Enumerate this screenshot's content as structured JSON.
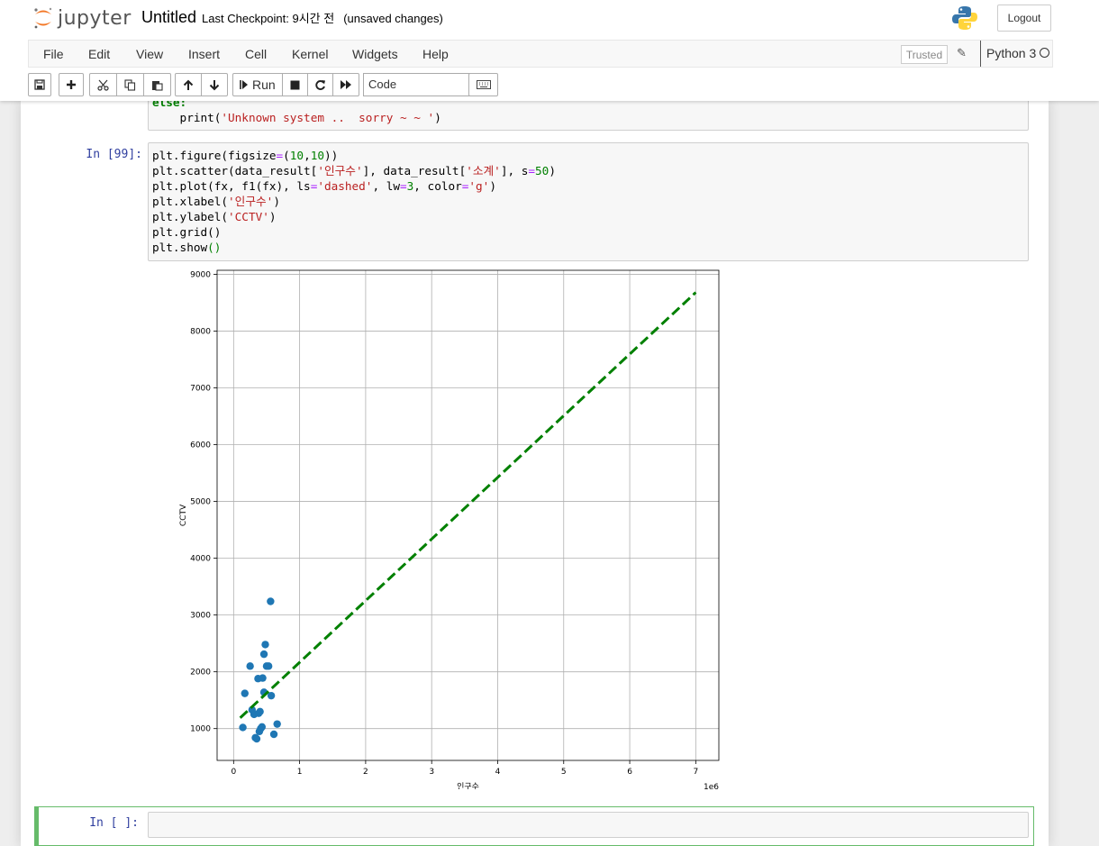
{
  "header": {
    "brand": "jupyter",
    "notebook_name": "Untitled",
    "checkpoint": "Last Checkpoint: 9시간 전",
    "autosave_status": "(unsaved changes)",
    "logout_label": "Logout"
  },
  "menu": {
    "items": [
      "File",
      "Edit",
      "View",
      "Insert",
      "Cell",
      "Kernel",
      "Widgets",
      "Help"
    ],
    "trusted_label": "Trusted",
    "kernel_name": "Python 3"
  },
  "toolbar": {
    "run_label": "Run",
    "cell_type": "Code"
  },
  "cells": {
    "prev_cell_lines": [
      "else:",
      "    print('Unknown system ..  sorry ~ ~ ')"
    ],
    "code_cell_prompt": "In [99]:",
    "code_lines": [
      "plt.figure(figsize=(10,10))",
      "plt.scatter(data_result['인구수'], data_result['소계'], s=50)",
      "plt.plot(fx, f1(fx), ls='dashed', lw=3, color='g')",
      "plt.xlabel('인구수')",
      "plt.ylabel('CCTV')",
      "plt.grid()",
      "plt.show()"
    ],
    "empty_cell_prompt": "In [ ]:"
  },
  "chart_data": {
    "type": "scatter",
    "xlabel": "인구수",
    "ylabel": "CCTV",
    "x_offset_label": "1e6",
    "xlim": [
      -0.25,
      7.35
    ],
    "ylim": [
      440,
      9070
    ],
    "xticks": [
      0,
      1,
      2,
      3,
      4,
      5,
      6,
      7
    ],
    "yticks": [
      1000,
      2000,
      3000,
      4000,
      5000,
      6000,
      7000,
      8000,
      9000
    ],
    "grid": true,
    "series": [
      {
        "kind": "scatter",
        "color": "#1f77b4",
        "points": [
          [
            0.14,
            1020
          ],
          [
            0.17,
            1620
          ],
          [
            0.25,
            2100
          ],
          [
            0.28,
            1330
          ],
          [
            0.31,
            1250
          ],
          [
            0.33,
            840
          ],
          [
            0.35,
            820
          ],
          [
            0.37,
            1880
          ],
          [
            0.38,
            1270
          ],
          [
            0.39,
            950
          ],
          [
            0.4,
            1300
          ],
          [
            0.41,
            1000
          ],
          [
            0.43,
            1030
          ],
          [
            0.44,
            1890
          ],
          [
            0.46,
            2310
          ],
          [
            0.46,
            1640
          ],
          [
            0.48,
            2480
          ],
          [
            0.5,
            2100
          ],
          [
            0.53,
            2100
          ],
          [
            0.56,
            3240
          ],
          [
            0.57,
            1580
          ],
          [
            0.61,
            900
          ],
          [
            0.66,
            1080
          ]
        ]
      },
      {
        "kind": "line",
        "style": "dashed",
        "color": "#008000",
        "x": [
          0.1,
          7.0
        ],
        "y": [
          1190,
          8680
        ]
      }
    ]
  },
  "colors": {
    "prompt": "#303F9F",
    "selected_cell_border": "#66BB6A",
    "jupyter_orange": "#F37726"
  }
}
